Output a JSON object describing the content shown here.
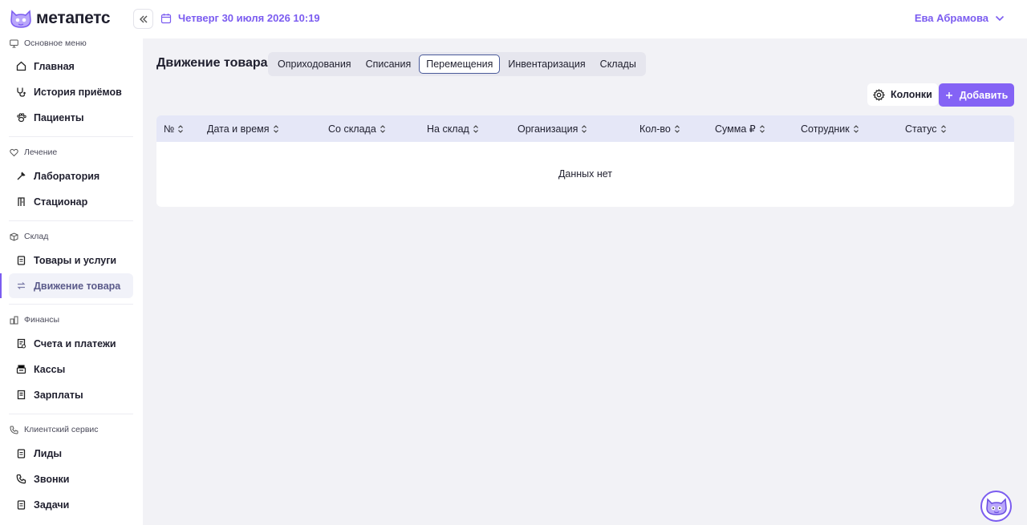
{
  "app": {
    "logo_text": "метапетс",
    "date": "Четверг 30 июля 2026 10:19",
    "user_name": "Ева Абрамова"
  },
  "sidebar": {
    "sections": [
      {
        "title": "Основное меню",
        "items": [
          "Главная",
          "История приёмов",
          "Пациенты"
        ]
      },
      {
        "title": "Лечение",
        "items": [
          "Лаборатория",
          "Стационар"
        ]
      },
      {
        "title": "Склад",
        "items": [
          "Товары и услуги",
          "Движение товара"
        ]
      },
      {
        "title": "Финансы",
        "items": [
          "Счета и платежи",
          "Кассы",
          "Зарплаты"
        ]
      },
      {
        "title": "Клиентский сервис",
        "items": [
          "Лиды",
          "Звонки",
          "Задачи"
        ]
      }
    ],
    "active_item": "Движение товара"
  },
  "page": {
    "title": "Движение товара",
    "tabs": [
      "Оприходования",
      "Списания",
      "Перемещения",
      "Инвентаризация",
      "Склады"
    ],
    "active_tab": "Перемещения",
    "columns_button": "Колонки",
    "add_button": "Добавить",
    "table": {
      "headers": [
        "№",
        "Дата и время",
        "Со склада",
        "На склад",
        "Организация",
        "Кол-во",
        "Сумма ₽",
        "Сотрудник",
        "Статус"
      ],
      "empty_text": "Данных нет"
    }
  },
  "colors": {
    "accent": "#7b5cf0",
    "button": "#8463f5",
    "header_row": "#e5e7f7",
    "background": "#f2f2f6"
  }
}
